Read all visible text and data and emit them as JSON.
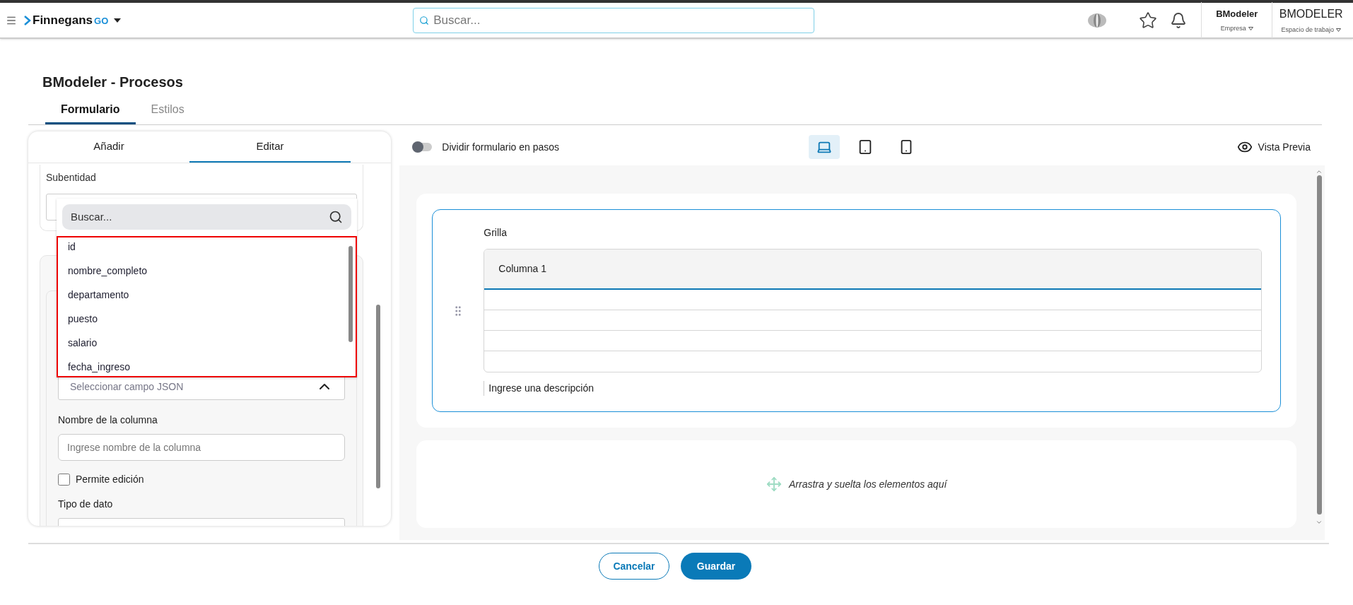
{
  "topbar": {
    "brand": "Finnegans",
    "brand_suffix": "GO",
    "search_placeholder": "Buscar...",
    "company": {
      "name": "BModeler",
      "label": "Empresa"
    },
    "workspace": {
      "name": "BMODELER",
      "label": "Espacio de trabajo"
    }
  },
  "page_title": "BModeler - Procesos",
  "tabs": [
    {
      "label": "Formulario",
      "selected": true
    },
    {
      "label": "Estilos",
      "selected": false
    }
  ],
  "left_panel": {
    "tabs": [
      {
        "label": "Añadir",
        "selected": false
      },
      {
        "label": "Editar",
        "selected": true
      }
    ],
    "subentidad_label": "Subentidad",
    "dropdown": {
      "search_placeholder": "Buscar...",
      "options": [
        "id",
        "nombre_completo",
        "departamento",
        "puesto",
        "salario",
        "fecha_ingreso"
      ]
    },
    "json_field": {
      "placeholder": "Seleccionar campo JSON",
      "expanded": true
    },
    "column_name": {
      "label": "Nombre de la columna",
      "placeholder": "Ingrese nombre de la columna"
    },
    "editable": {
      "label": "Permite edición",
      "checked": false
    },
    "data_type_label": "Tipo de dato"
  },
  "toolbar": {
    "split_steps": {
      "label": "Dividir formulario en pasos",
      "on": false
    },
    "devices": [
      {
        "kind": "laptop",
        "selected": true
      },
      {
        "kind": "tablet",
        "selected": false
      },
      {
        "kind": "phone",
        "selected": false
      }
    ],
    "preview": "Vista Previa"
  },
  "canvas": {
    "grid": {
      "title": "Grilla",
      "columns": [
        "Columna 1"
      ],
      "description": "Ingrese una descripción"
    },
    "dropzone": "Arrastra y suelta los elementos aquí"
  },
  "buttons": [
    {
      "label": "Cancelar",
      "kind": "secondary"
    },
    {
      "label": "Guardar",
      "kind": "primary"
    }
  ]
}
